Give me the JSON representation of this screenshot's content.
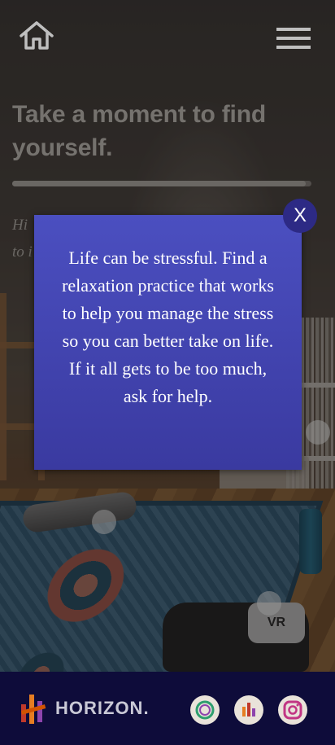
{
  "header": {
    "home_icon": "home-icon",
    "menu_icon": "hamburger-menu-icon"
  },
  "main": {
    "headline": "Take a moment to find yourself.",
    "progress_fraction": 0.98,
    "hint_text": "Hi... to i..."
  },
  "modal": {
    "message": "Life can be stressful. Find a relaxation practice that works to help you manage the stress so you can better take on life. If it all gets to be too much, ask for help.",
    "close_label": "X",
    "background_color": "#4b4fc0"
  },
  "footer": {
    "brand_name": "HORIZON.",
    "background_color": "#0e0c3a",
    "social_icons": [
      "circle-logo-icon",
      "bar-logo-icon",
      "instagram-icon"
    ]
  }
}
